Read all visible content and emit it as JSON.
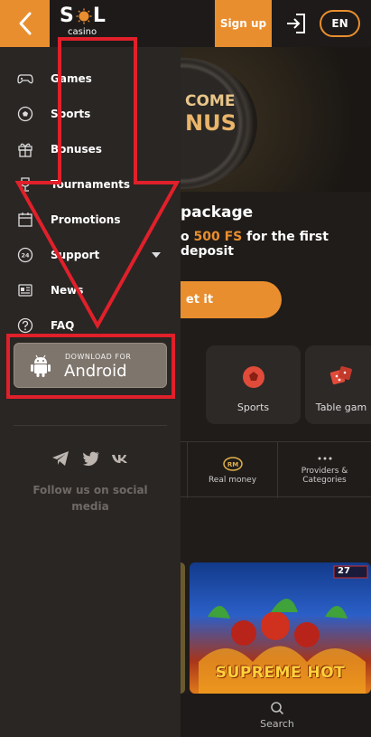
{
  "header": {
    "logo_word_left": "S",
    "logo_word_right": "L",
    "logo_sub": "casino",
    "signup_label": "Sign up",
    "lang_label": "EN"
  },
  "hero": {
    "badge_line1": "COME",
    "badge_line2": "NUS",
    "promo_title": "package",
    "promo_sub_prefix": "o",
    "promo_sub_highlight": "500 FS",
    "promo_sub_suffix": "for the first deposit",
    "cta_label": "et it"
  },
  "categories": [
    {
      "label": "Sports",
      "icon": "soccer-ball-icon"
    },
    {
      "label": "Table gam",
      "icon": "dice-icon"
    }
  ],
  "filters": [
    {
      "label": "Real money",
      "icon": "rm-coin-icon"
    },
    {
      "label": "Providers &\nCategories",
      "icon": "more-dots-icon"
    }
  ],
  "game_tiles": [
    {
      "title": "SUPREME HOT",
      "badge": "27"
    }
  ],
  "bottom_nav": {
    "search_label": "Search"
  },
  "drawer": {
    "items": [
      {
        "label": "Games",
        "icon": "gamepad-icon"
      },
      {
        "label": "Sports",
        "icon": "soccer-ball-icon"
      },
      {
        "label": "Bonuses",
        "icon": "gift-icon"
      },
      {
        "label": "Tournaments",
        "icon": "trophy-icon"
      },
      {
        "label": "Promotions",
        "icon": "calendar-icon"
      },
      {
        "label": "Support",
        "icon": "support-24-icon"
      },
      {
        "label": "News",
        "icon": "newspaper-icon"
      },
      {
        "label": "FAQ",
        "icon": "question-icon"
      }
    ],
    "android": {
      "small": "DOWNLOAD FOR",
      "big": "Android"
    },
    "social_icons": [
      "telegram-icon",
      "twitter-icon",
      "vk-icon"
    ],
    "follow_text": "Follow us on social media"
  },
  "colors": {
    "accent": "#e98e2e",
    "background": "#201c1a",
    "drawer": "#2a2624",
    "annotation": "#e0202a"
  }
}
